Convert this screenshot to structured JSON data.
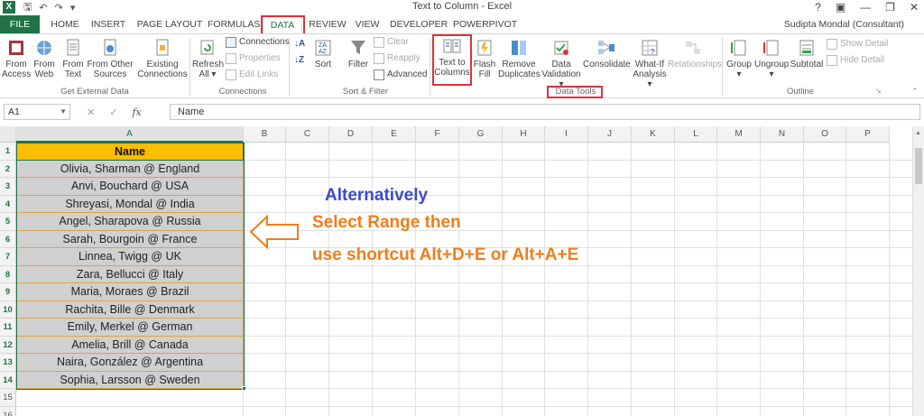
{
  "window": {
    "title": "Text to Column - Excel",
    "user": "Sudipta Mondal (Consultant)",
    "help": "?",
    "app_icon": "X"
  },
  "tabs": [
    "FILE",
    "HOME",
    "INSERT",
    "PAGE LAYOUT",
    "FORMULAS",
    "DATA",
    "REVIEW",
    "VIEW",
    "DEVELOPER",
    "POWERPIVOT"
  ],
  "active_tab": "DATA",
  "ribbon": {
    "from_access": [
      "From",
      "Access"
    ],
    "from_web": [
      "From",
      "Web"
    ],
    "from_text": [
      "From",
      "Text"
    ],
    "from_other": [
      "From Other",
      "Sources"
    ],
    "existing": [
      "Existing",
      "Connections"
    ],
    "group_external": "Get External Data",
    "refresh": [
      "Refresh",
      "All"
    ],
    "connections": "Connections",
    "properties": "Properties",
    "edit_links": "Edit Links",
    "group_connections": "Connections",
    "sort": "Sort",
    "filter": "Filter",
    "clear": "Clear",
    "reapply": "Reapply",
    "advanced": "Advanced",
    "group_sort": "Sort & Filter",
    "text_to_columns": [
      "Text to",
      "Columns"
    ],
    "flash_fill": [
      "Flash",
      "Fill"
    ],
    "remove_dup": [
      "Remove",
      "Duplicates"
    ],
    "data_validation": [
      "Data",
      "Validation"
    ],
    "consolidate": "Consolidate",
    "whatif": [
      "What-If",
      "Analysis"
    ],
    "relationships": "Relationships",
    "group_datatools": "Data Tools",
    "group": "Group",
    "ungroup": "Ungroup",
    "subtotal": "Subtotal",
    "show_detail": "Show Detail",
    "hide_detail": "Hide Detail",
    "group_outline": "Outline"
  },
  "formula_bar": {
    "name_box": "A1",
    "fx": "fx",
    "content": "Name"
  },
  "columns": [
    "A",
    "B",
    "C",
    "D",
    "E",
    "F",
    "G",
    "H",
    "I",
    "J",
    "K",
    "L",
    "M",
    "N",
    "O",
    "P"
  ],
  "rows": [
    "1",
    "2",
    "3",
    "4",
    "5",
    "6",
    "7",
    "8",
    "9",
    "10",
    "11",
    "12",
    "13",
    "14",
    "15",
    "16"
  ],
  "cells": [
    "Name",
    "Olivia, Sharman @ England",
    "Anvi, Bouchard @ USA",
    "Shreyasi, Mondal @ India",
    "Angel, Sharapova @ Russia",
    "Sarah, Bourgoin @ France",
    "Linnea, Twigg @ UK",
    "Zara, Bellucci @ Italy",
    "Maria, Moraes @ Brazil",
    "Rachita, Bille @ Denmark",
    "Emily, Merkel @ German",
    "Amelia, Brill @ Canada",
    "Naira, González @ Argentina",
    "Sophia, Larsson @ Sweden"
  ],
  "annotation": {
    "line1": "Alternatively",
    "line2": "Select Range then",
    "line3": "use shortcut Alt+D+E or Alt+A+E"
  },
  "colors": {
    "excel_green": "#217346",
    "header_fill": "#fbbd00",
    "data_fill": "#d0d0d0",
    "highlight_red": "#e0303a",
    "annot_blue": "#3b4bd0",
    "annot_orange": "#f07d1a"
  }
}
